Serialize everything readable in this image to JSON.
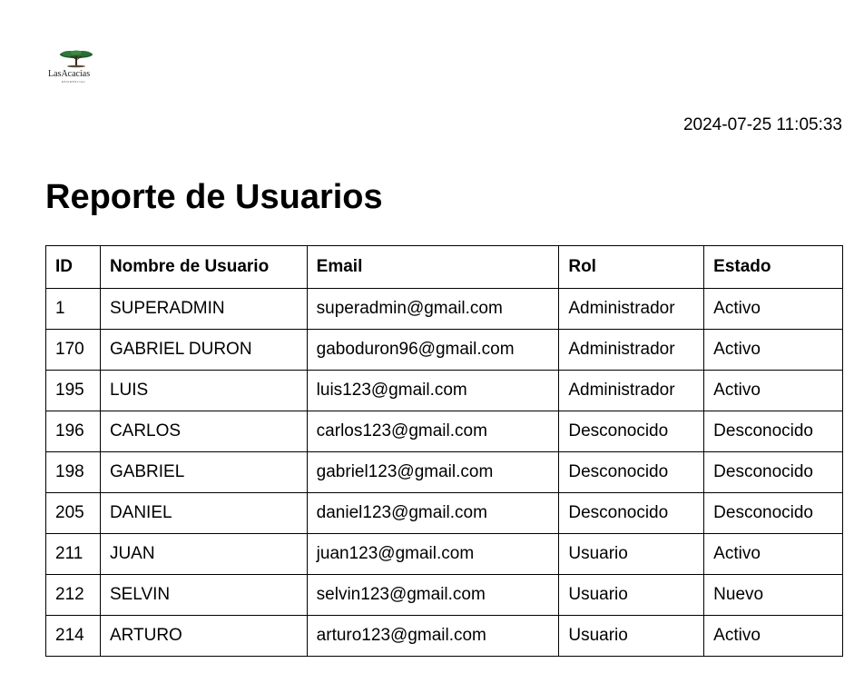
{
  "logo": {
    "name": "LasAcacias",
    "tagline": "RESIDENCIAL"
  },
  "timestamp": "2024-07-25 11:05:33",
  "title": "Reporte de Usuarios",
  "table": {
    "headers": [
      "ID",
      "Nombre de Usuario",
      "Email",
      "Rol",
      "Estado"
    ],
    "rows": [
      [
        "1",
        "SUPERADMIN",
        "superadmin@gmail.com",
        "Administrador",
        "Activo"
      ],
      [
        "170",
        "GABRIEL DURON",
        "gaboduron96@gmail.com",
        "Administrador",
        "Activo"
      ],
      [
        "195",
        "LUIS",
        "luis123@gmail.com",
        "Administrador",
        "Activo"
      ],
      [
        "196",
        "CARLOS",
        "carlos123@gmail.com",
        "Desconocido",
        "Desconocido"
      ],
      [
        "198",
        "GABRIEL",
        "gabriel123@gmail.com",
        "Desconocido",
        "Desconocido"
      ],
      [
        "205",
        "DANIEL",
        "daniel123@gmail.com",
        "Desconocido",
        "Desconocido"
      ],
      [
        "211",
        "JUAN",
        "juan123@gmail.com",
        "Usuario",
        "Activo"
      ],
      [
        "212",
        "SELVIN",
        "selvin123@gmail.com",
        "Usuario",
        "Nuevo"
      ],
      [
        "214",
        "ARTURO",
        "arturo123@gmail.com",
        "Usuario",
        "Activo"
      ]
    ]
  }
}
